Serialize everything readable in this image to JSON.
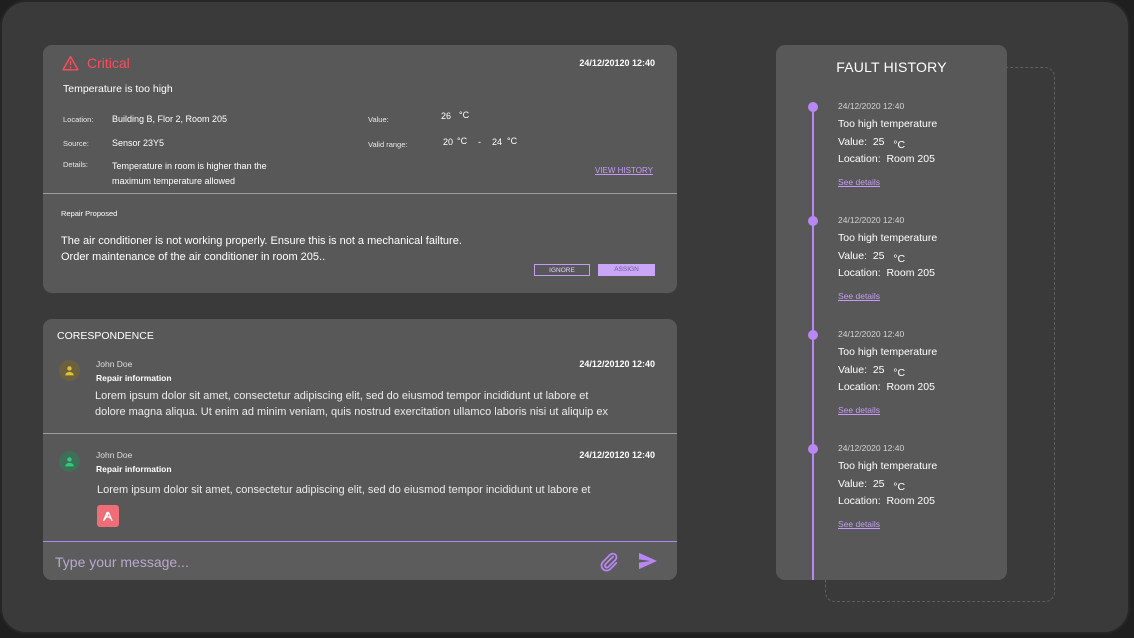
{
  "colors": {
    "critical": "#ff4b5c",
    "accent": "#b987f5",
    "link": "#c49cf5"
  },
  "alert": {
    "severity": "Critical",
    "severity_icon": "warning-triangle-icon",
    "date": "24/12/20120 12:40",
    "title": "Temperature is too high",
    "location_label": "Location:",
    "location": "Building B, Flor 2, Room 205",
    "source_label": "Source:",
    "source": "Sensor 23Y5",
    "details_label": "Details:",
    "details_line1": "Temperature in room is higher than the",
    "details_line2": "maximum temperature allowed",
    "value_label": "Value:",
    "value": "26",
    "value_unit": "°C",
    "range_label": "Valid range:",
    "range_min": "20",
    "range_min_unit": "°C",
    "range_sep": "-",
    "range_max": "24",
    "range_max_unit": "°C",
    "view_history": "VIEW HISTORY",
    "repair_heading": "Repair Proposed",
    "repair_line1": "The air conditioner is not working properly. Ensure this is not a mechanical failture.",
    "repair_line2": "Order maintenance of the air conditioner in room 205..",
    "ignore_label": "IGNORE",
    "assign_label": "ASSIGN"
  },
  "correspondence": {
    "title": "CORESPONDENCE",
    "messages": [
      {
        "author": "John Doe",
        "subject": "Repair information",
        "date": "24/12/20120 12:40",
        "body_line1": "Lorem ipsum dolor sit amet, consectetur adipiscing elit, sed do eiusmod tempor incididunt ut labore et",
        "body_line2": "dolore magna aliqua. Ut enim ad minim veniam, quis nostrud exercitation ullamco laboris nisi ut aliquip ex",
        "avatar_icon": "user-icon",
        "avatar_color": "#e0c22a"
      },
      {
        "author": "John Doe",
        "subject": "Repair information",
        "date": "24/12/20120 12:40",
        "body_line1": "Lorem ipsum dolor sit amet, consectetur adipiscing elit, sed do eiusmod tempor incididunt ut labore et",
        "avatar_icon": "user-icon",
        "avatar_color": "#2fcf7a",
        "attachment_icon": "pdf-icon"
      }
    ],
    "composer_placeholder": "Type your message...",
    "attach_icon": "paperclip-icon",
    "send_icon": "send-icon"
  },
  "history": {
    "title": "FAULT HISTORY",
    "items": [
      {
        "date": "24/12/2020 12:40",
        "title": "Too high temperature",
        "value_label": "Value:",
        "value": "25",
        "unit": "°C",
        "location_label": "Location:",
        "location": "Room 205",
        "link": "See details"
      },
      {
        "date": "24/12/2020 12:40",
        "title": "Too high temperature",
        "value_label": "Value:",
        "value": "25",
        "unit": "°C",
        "location_label": "Location:",
        "location": "Room 205",
        "link": "See details"
      },
      {
        "date": "24/12/2020 12:40",
        "title": "Too high temperature",
        "value_label": "Value:",
        "value": "25",
        "unit": "°C",
        "location_label": "Location:",
        "location": "Room 205",
        "link": "See details"
      },
      {
        "date": "24/12/2020 12:40",
        "title": "Too high temperature",
        "value_label": "Value:",
        "value": "25",
        "unit": "°C",
        "location_label": "Location:",
        "location": "Room 205",
        "link": "See details"
      }
    ]
  }
}
